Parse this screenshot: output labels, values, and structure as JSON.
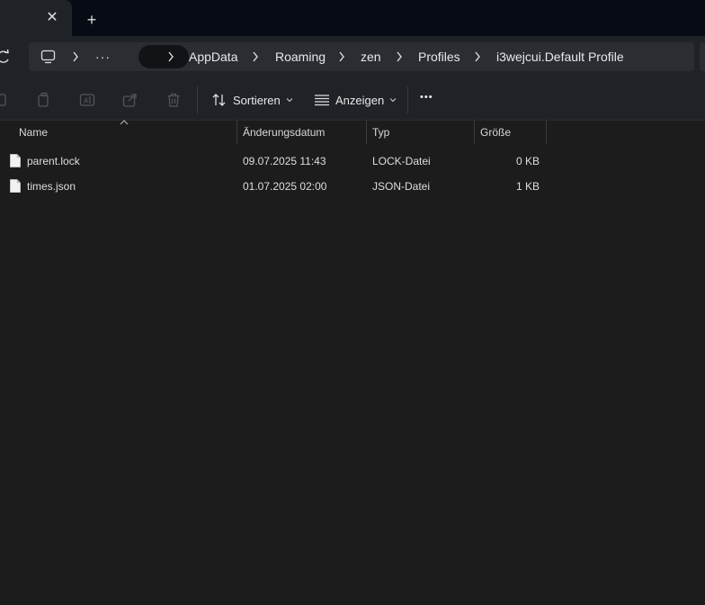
{
  "tabbar": {
    "close_glyph": "✕",
    "new_tab_glyph": "+"
  },
  "address": {
    "ellipsis": "···",
    "crumbs": [
      "AppData",
      "Roaming",
      "zen",
      "Profiles",
      "i3wejcui.Default Profile"
    ]
  },
  "toolbar": {
    "sort_label": "Sortieren",
    "view_label": "Anzeigen",
    "more_glyph": "•••"
  },
  "columns": {
    "name": "Name",
    "date": "Änderungsdatum",
    "type": "Typ",
    "size": "Größe"
  },
  "files": [
    {
      "name": "parent.lock",
      "date": "09.07.2025 11:43",
      "type": "LOCK-Datei",
      "size": "0 KB"
    },
    {
      "name": "times.json",
      "date": "01.07.2025 02:00",
      "type": "JSON-Datei",
      "size": "1 KB"
    }
  ],
  "colors": {
    "titlebar": "#060b14",
    "chrome": "#1f2328",
    "background": "#1c1c1c",
    "accent": "#60cdff"
  }
}
